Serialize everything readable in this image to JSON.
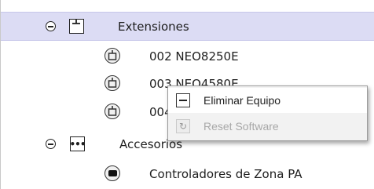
{
  "tree": {
    "rows": [
      {
        "label": "Extensiones"
      },
      {
        "label": "002 NEO8250E"
      },
      {
        "label": "003 NEO4580E"
      },
      {
        "label": "004 NEO"
      },
      {
        "label": "Accesorios"
      },
      {
        "label": "Controladores de Zona PA"
      }
    ]
  },
  "context_menu": {
    "items": [
      {
        "label": "Eliminar Equipo",
        "enabled": true
      },
      {
        "label": "Reset Software",
        "enabled": false
      }
    ]
  },
  "colors": {
    "selection": "#dcdcf4",
    "menu_bg": "#f2f2f2",
    "disabled_text": "#a8a8a8"
  }
}
